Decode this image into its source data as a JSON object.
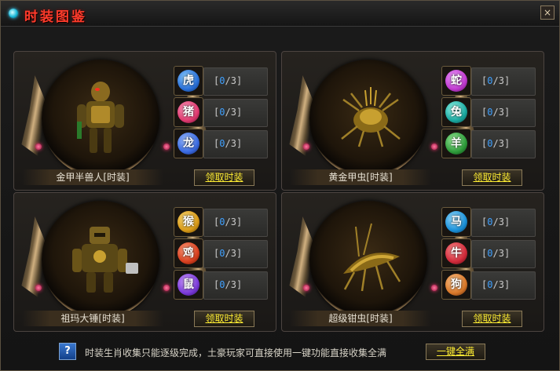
{
  "window": {
    "title": "时装图鉴",
    "close_label": "×"
  },
  "colors": {
    "accent_red": "#ff3b2b",
    "counter_blue": "#3fa0ff",
    "button_yellow": "#ffee33"
  },
  "panels": [
    {
      "name": "金甲半兽人[时装]",
      "claim_label": "领取时装",
      "slots": [
        {
          "icon": "tiger-zodiac-icon",
          "glyph": "虎",
          "color": "#2a70d8",
          "current": "0",
          "total": "3"
        },
        {
          "icon": "pig-zodiac-icon",
          "glyph": "猪",
          "color": "#e03a70",
          "current": "0",
          "total": "3"
        },
        {
          "icon": "dragon-zodiac-icon",
          "glyph": "龙",
          "color": "#3a6ae0",
          "current": "0",
          "total": "3"
        }
      ]
    },
    {
      "name": "黄金甲虫[时装]",
      "claim_label": "领取时装",
      "slots": [
        {
          "icon": "snake-zodiac-icon",
          "glyph": "蛇",
          "color": "#c03ad0",
          "current": "0",
          "total": "3"
        },
        {
          "icon": "rabbit-zodiac-icon",
          "glyph": "兔",
          "color": "#1aa8a0",
          "current": "0",
          "total": "3"
        },
        {
          "icon": "goat-zodiac-icon",
          "glyph": "羊",
          "color": "#2e9a3a",
          "current": "0",
          "total": "3"
        }
      ]
    },
    {
      "name": "祖玛大锤[时装]",
      "claim_label": "领取时装",
      "slots": [
        {
          "icon": "monkey-zodiac-icon",
          "glyph": "猴",
          "color": "#d89a18",
          "current": "0",
          "total": "3"
        },
        {
          "icon": "rooster-zodiac-icon",
          "glyph": "鸡",
          "color": "#d84020",
          "current": "0",
          "total": "3"
        },
        {
          "icon": "rat-zodiac-icon",
          "glyph": "鼠",
          "color": "#7a3ad8",
          "current": "0",
          "total": "3"
        }
      ]
    },
    {
      "name": "超级钳虫[时装]",
      "claim_label": "领取时装",
      "slots": [
        {
          "icon": "horse-zodiac-icon",
          "glyph": "马",
          "color": "#1a90d8",
          "current": "0",
          "total": "3"
        },
        {
          "icon": "ox-zodiac-icon",
          "glyph": "牛",
          "color": "#d02a3a",
          "current": "0",
          "total": "3"
        },
        {
          "icon": "dog-zodiac-icon",
          "glyph": "狗",
          "color": "#d8782a",
          "current": "0",
          "total": "3"
        }
      ]
    }
  ],
  "footer": {
    "help_label": "?",
    "text": "时装生肖收集只能逐级完成，土豪玩家可直接使用一键功能直接收集全满",
    "collect_all_label": "一键全满"
  }
}
